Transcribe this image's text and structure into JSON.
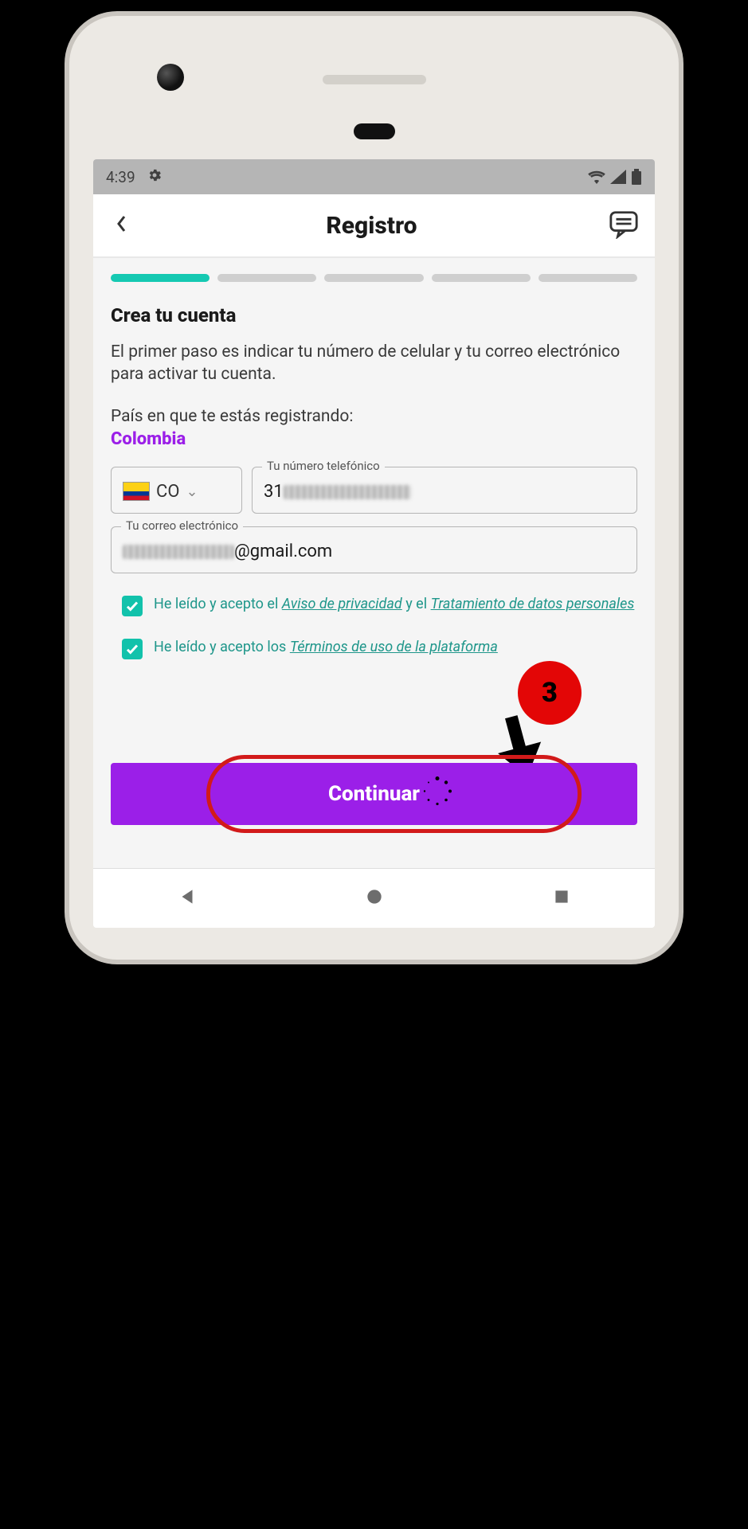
{
  "statusbar": {
    "time": "4:39"
  },
  "header": {
    "title": "Registro"
  },
  "progress": {
    "total_steps": 5,
    "active_step": 1
  },
  "form": {
    "section_title": "Crea tu cuenta",
    "description": "El primer paso es indicar tu número de celular y tu correo electrónico para activar tu cuenta.",
    "country_label": "País en que te estás registrando:",
    "country_value": "Colombia",
    "country_code_label": "CO",
    "phone_label": "Tu número telefónico",
    "phone_prefix_visible": "31",
    "email_label": "Tu correo electrónico",
    "email_suffix_visible": "@gmail.com"
  },
  "consents": {
    "privacy": {
      "checked": true,
      "prefix": "He leído y acepto el ",
      "link1": "Aviso de privacidad",
      "middle": " y el ",
      "link2": "Tratamiento de datos personales"
    },
    "terms": {
      "checked": true,
      "prefix": "He leído y acepto los ",
      "link": "Términos de uso de la plataforma"
    }
  },
  "cta": {
    "label": "Continuar"
  },
  "annotation": {
    "step_number": "3"
  },
  "colors": {
    "accent_teal": "#12c2ab",
    "accent_purple": "#9b1fe8",
    "annotation_red": "#e30606"
  }
}
